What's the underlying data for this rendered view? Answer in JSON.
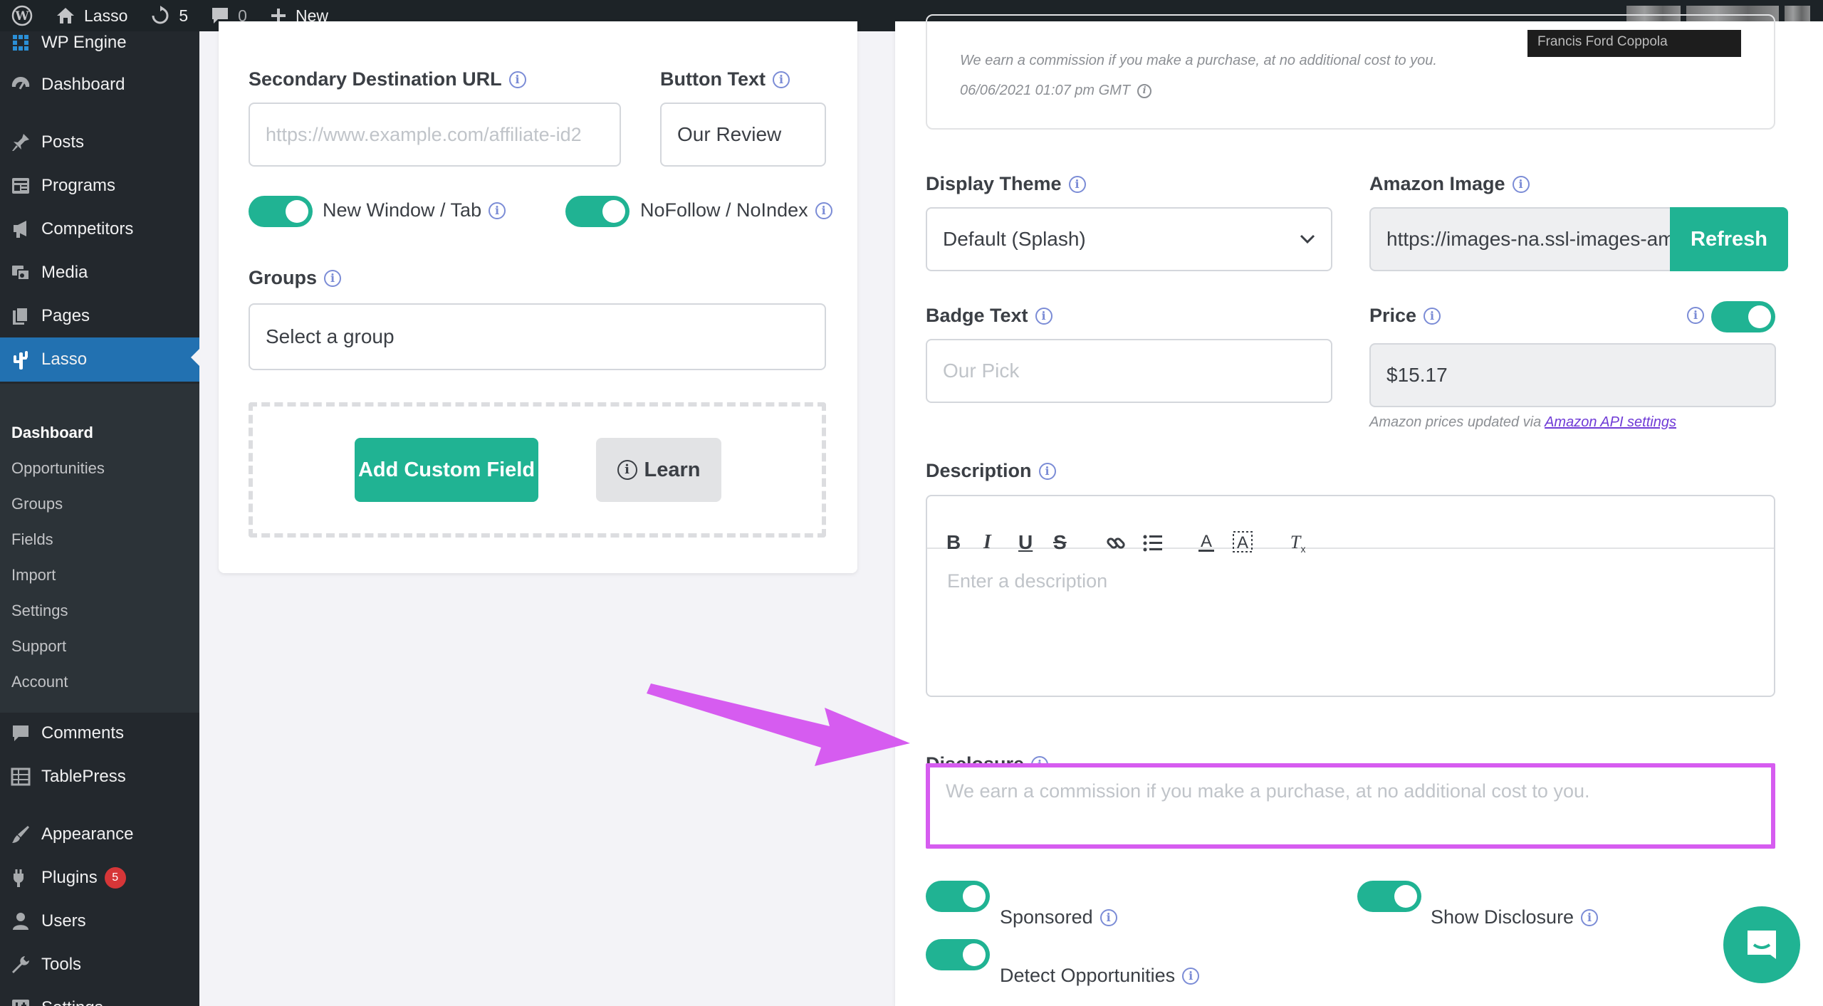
{
  "admin_bar": {
    "site_name": "Lasso",
    "updates_count": "5",
    "comments_count": "0",
    "new_label": "New"
  },
  "sidebar": {
    "top_label": "WP Engine",
    "items": [
      {
        "label": "Dashboard",
        "icon": "dashboard-icon"
      },
      {
        "label": "Posts",
        "icon": "pin-icon"
      },
      {
        "label": "Programs",
        "icon": "programs-icon"
      },
      {
        "label": "Competitors",
        "icon": "megaphone-icon"
      },
      {
        "label": "Media",
        "icon": "media-icon"
      },
      {
        "label": "Pages",
        "icon": "pages-icon"
      },
      {
        "label": "Lasso",
        "icon": "lasso-icon"
      }
    ],
    "submenu": [
      "Dashboard",
      "Opportunities",
      "Groups",
      "Fields",
      "Import",
      "Settings",
      "Support",
      "Account"
    ],
    "items_bottom": [
      {
        "label": "Comments",
        "icon": "comment-icon"
      },
      {
        "label": "TablePress",
        "icon": "table-icon"
      },
      {
        "label": "Appearance",
        "icon": "brush-icon"
      },
      {
        "label": "Plugins",
        "icon": "plug-icon",
        "badge": "5"
      },
      {
        "label": "Users",
        "icon": "user-icon"
      },
      {
        "label": "Tools",
        "icon": "wrench-icon"
      },
      {
        "label": "Settings",
        "icon": "settings-icon"
      }
    ]
  },
  "left_card": {
    "secondary_url_label": "Secondary Destination URL",
    "secondary_url_placeholder": "https://www.example.com/affiliate-id2",
    "button_text_label": "Button Text",
    "button_text_value": "Our Review",
    "new_window_label": "New Window / Tab",
    "nofollow_label": "NoFollow / NoIndex",
    "groups_label": "Groups",
    "groups_placeholder": "Select a group",
    "add_field_label": "Add Custom Field",
    "learn_label": "Learn"
  },
  "right_card": {
    "preview_disclosure": "We earn a commission if you make a purchase, at no additional cost to you.",
    "preview_date": "06/06/2021 01:07 pm GMT",
    "preview_caption": "Francis Ford Coppola",
    "display_theme_label": "Display Theme",
    "display_theme_value": "Default (Splash)",
    "amazon_image_label": "Amazon Image",
    "amazon_image_value": "https://images-na.ssl-images-amazon.com",
    "refresh_label": "Refresh",
    "badge_text_label": "Badge Text",
    "badge_text_placeholder": "Our Pick",
    "price_label": "Price",
    "price_value": "$15.17",
    "price_note": "Amazon prices updated via",
    "price_note_link": "Amazon API settings",
    "description_label": "Description",
    "description_placeholder": "Enter a description",
    "disclosure_label": "Disclosure",
    "disclosure_placeholder": "We earn a commission if you make a purchase, at no additional cost to you.",
    "sponsored_label": "Sponsored",
    "show_disclosure_label": "Show Disclosure",
    "detect_opportunities_label": "Detect Opportunities"
  },
  "colors": {
    "accent": "#20b393",
    "highlight": "#d65cf0",
    "wp_blue": "#2271b1"
  }
}
